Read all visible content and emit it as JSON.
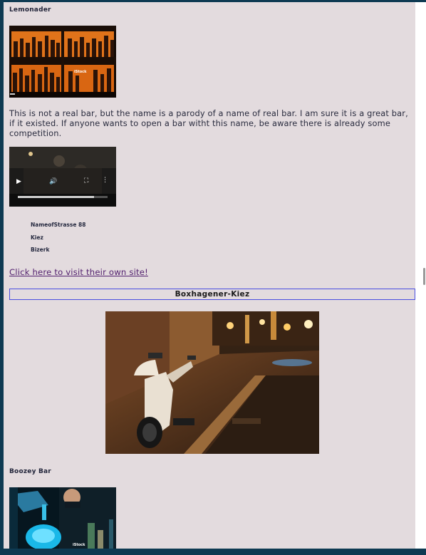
{
  "bars": [
    {
      "title": "Lemonader",
      "description": "This is not a real bar, but the name is a parody of a name of real bar. I am sure it is a great bar, if it existed. If anyone wants to open a bar witht this name, be aware there is already some competition.",
      "address": [
        "NameofStrasse 88",
        "Kiez",
        "Bizerk"
      ],
      "link_text": "Click here to visit their own site!",
      "image": {
        "kind": "bar-shelves-photo",
        "watermark": "iStock"
      },
      "video": {
        "controls": [
          "play-icon",
          "volume-icon",
          "fullscreen-icon",
          "more-icon"
        ],
        "progress": 0.85
      }
    },
    {
      "title": "Boozey Bar",
      "image": {
        "kind": "cocktail-pouring-photo",
        "watermark": "iStock"
      }
    }
  ],
  "section": {
    "title": "Boxhagener-Kiez",
    "image": {
      "kind": "scooter-street-night-photo"
    }
  },
  "colors": {
    "page_bg": "#e3dbde",
    "frame": "#0e3a52",
    "link": "#52206e",
    "section_border": "#4a4ee0"
  }
}
